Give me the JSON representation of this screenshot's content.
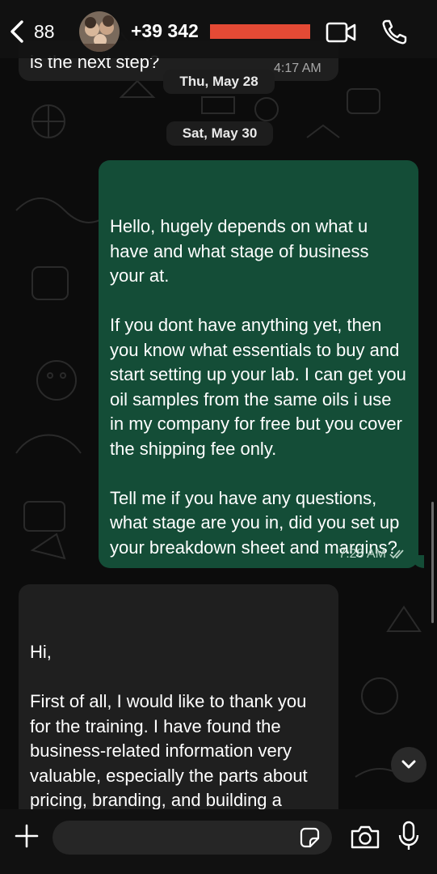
{
  "header": {
    "back_count": "88",
    "contact_phone": "+39 342",
    "icons": [
      "chevron-left-icon",
      "video-call-icon",
      "phone-call-icon"
    ]
  },
  "messages": {
    "previous_fragment": {
      "text": "is the next step?",
      "time": "4:17 AM"
    },
    "date_1": "Thu, May 28",
    "date_2": "Sat, May 30",
    "outgoing": {
      "text": "Hello, hugely depends on what u have and what stage of business your at.\n\nIf you dont have anything yet, then you know what essentials to buy and start setting up your lab. I can get you oil samples from the same oils i use in my company for free but you cover the shipping fee only.\n\nTell me if you have any questions, what stage are you in, did you set up your breakdown sheet and margins?",
      "time": "7:28 AM",
      "status": "read"
    },
    "incoming": {
      "text": "Hi,\n\nFirst of all, I would like to thank you for the training. I have found the business-related information very valuable, especially the parts about pricing, branding, and building a perfume business."
    }
  },
  "composer": {
    "placeholder": "",
    "icons": [
      "plus-icon",
      "sticker-icon",
      "camera-icon",
      "microphone-icon"
    ]
  },
  "colors": {
    "outgoing_bubble": "#144d37",
    "incoming_bubble": "#1f1f1f",
    "redaction": "#e44a35",
    "background": "#0c0c0c"
  }
}
